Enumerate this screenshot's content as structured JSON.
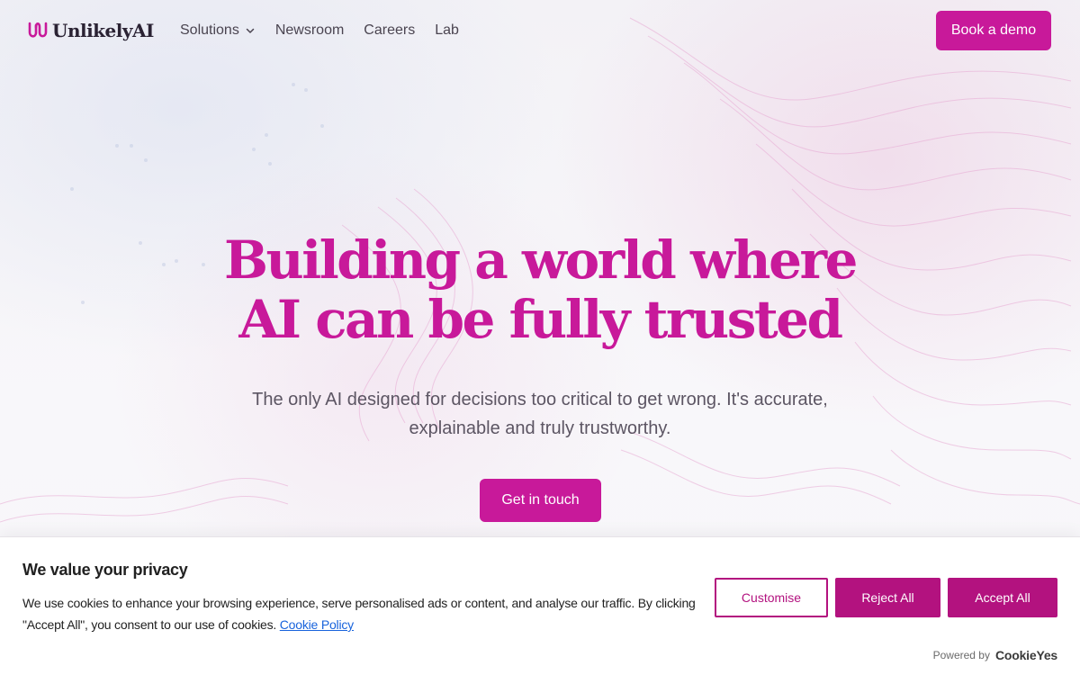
{
  "header": {
    "logo_text": "UnlikelyAI",
    "nav": [
      {
        "label": "Solutions",
        "has_dropdown": true
      },
      {
        "label": "Newsroom"
      },
      {
        "label": "Careers"
      },
      {
        "label": "Lab"
      }
    ],
    "cta_label": "Book a demo"
  },
  "hero": {
    "title_line1": "Building a world where",
    "title_line2": "AI can be fully trusted",
    "subtitle": "The only AI designed for decisions too critical to get wrong. It's accurate, explainable and truly trustworthy.",
    "cta_label": "Get in touch"
  },
  "cookie_banner": {
    "title": "We value your privacy",
    "text": "We use cookies to enhance your browsing experience, serve personalised ads or content, and analyse our traffic. By clicking \"Accept All\", you consent to our use of cookies.",
    "link_text": "Cookie Policy",
    "buttons": {
      "customise": "Customise",
      "reject": "Reject All",
      "accept": "Accept All"
    },
    "powered_by_label": "Powered by",
    "powered_by_brand": "CookieYes"
  },
  "colors": {
    "brand": "#c8199a",
    "cookie_accent": "#b3127f",
    "link": "#1863dc"
  },
  "icons": [
    "logo-mark-icon",
    "chevron-down-icon"
  ]
}
